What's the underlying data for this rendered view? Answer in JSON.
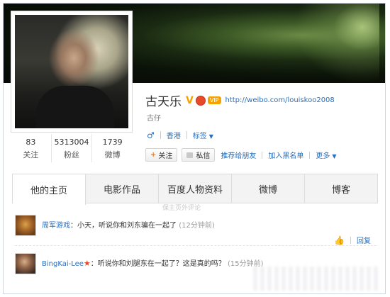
{
  "profile": {
    "name": "古天乐",
    "verified_mark": "V",
    "vip_tag": "VIP",
    "url": "http://weibo.com/louiskoo2008",
    "nickname": "古仔",
    "gender_icon": "male-icon",
    "location": "香港",
    "tags_label": "标签"
  },
  "stats": [
    {
      "value": "83",
      "label": "关注"
    },
    {
      "value": "5313004",
      "label": "粉丝"
    },
    {
      "value": "1739",
      "label": "微博"
    }
  ],
  "actions": {
    "follow": "关注",
    "message": "私信",
    "recommend": "推荐给朋友",
    "blacklist": "加入黑名单",
    "more": "更多"
  },
  "tabs": [
    "他的主页",
    "电影作品",
    "百度人物资料",
    "微博",
    "博客"
  ],
  "faded_text": "保主页外评论",
  "comments": [
    {
      "user": "周军游戏",
      "text": "：小天，听说你和刘东骗在一起了",
      "time": "(12分钟前)",
      "reply": "回复"
    },
    {
      "user": "BingKai-Lee",
      "text": "：听说你和刘腿东在一起了？这是真的吗？",
      "time": "(15分钟前)"
    }
  ],
  "colors": {
    "link": "#2a6fbe",
    "accent": "#f3a200"
  }
}
